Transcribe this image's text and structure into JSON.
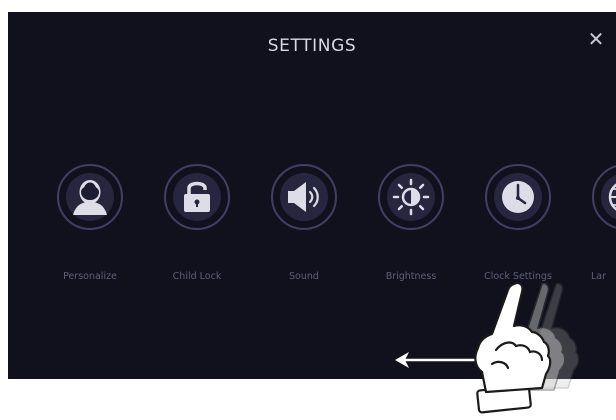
{
  "header": {
    "title": "SETTINGS",
    "close_glyph": "✕",
    "close_icon": "close-icon"
  },
  "menu": {
    "items": [
      {
        "label": "Personalize",
        "icon": "person-icon"
      },
      {
        "label": "Child Lock",
        "icon": "padlock-icon"
      },
      {
        "label": "Sound",
        "icon": "speaker-icon"
      },
      {
        "label": "Brightness",
        "icon": "brightness-icon"
      },
      {
        "label": "Clock Settings",
        "icon": "clock-icon"
      },
      {
        "label": "Lar",
        "icon": "globe-icon"
      }
    ]
  },
  "overlay": {
    "gesture": "swipe-left",
    "arrow_icon": "left-arrow-icon",
    "hand_icon": "swipe-hand-icon"
  },
  "colors": {
    "background": "#11111e",
    "circle_fill": "#26273f",
    "icon": "#dcdde6",
    "label": "#5e5f7a",
    "title": "#d9dae3"
  }
}
